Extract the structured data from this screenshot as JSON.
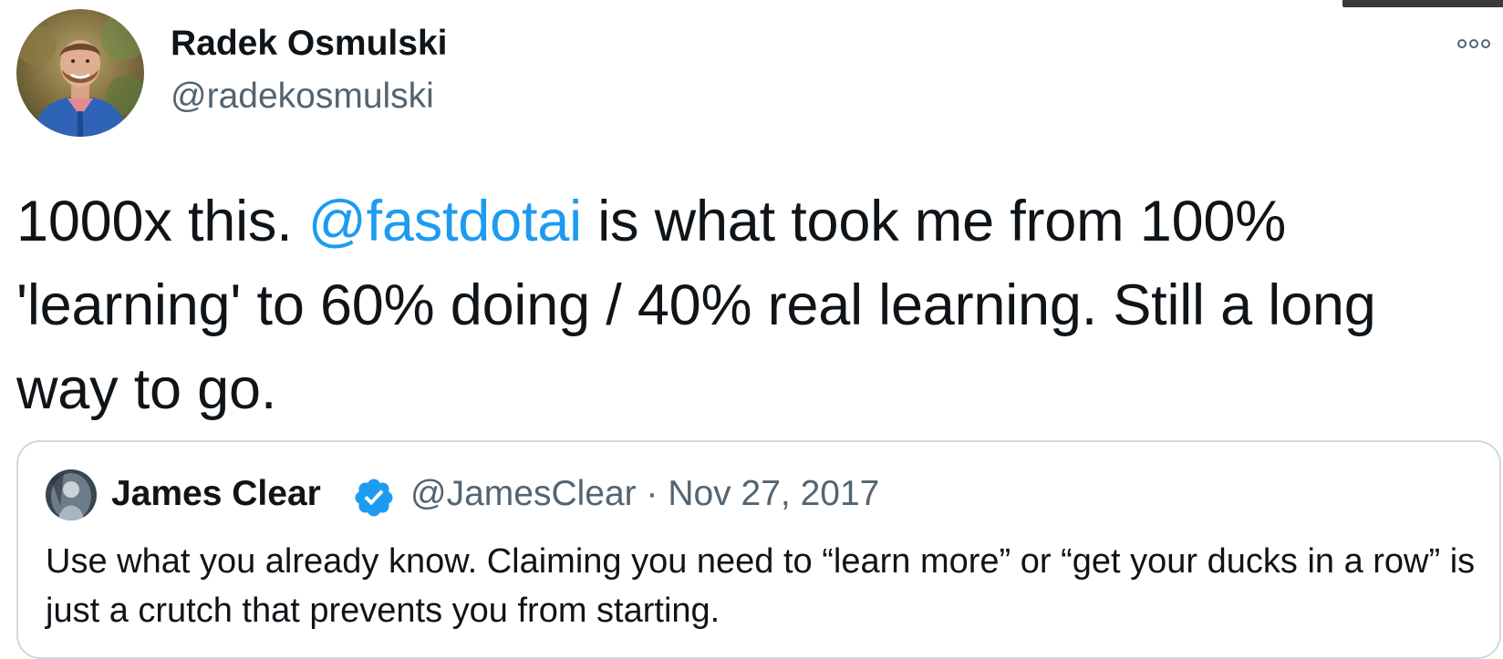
{
  "tweet": {
    "author": {
      "display_name": "Radek Osmulski",
      "handle": "@radekosmulski"
    },
    "text": {
      "before_mention": "1000x this. ",
      "mention": "@fastdotai",
      "after_mention": " is what took me from 100% 'learning' to 60% doing / 40% real learning. Still a long way to go."
    },
    "more_icon": "more-horizontal-icon"
  },
  "quoted_tweet": {
    "author": {
      "display_name": "James Clear",
      "verified_icon": "verified-badge-icon",
      "handle": "@JamesClear"
    },
    "separator": " · ",
    "date": "Nov 27, 2017",
    "text": "Use what you already know. Claiming you need to “learn more” or “get your ducks in a row” is just a crutch that prevents you from starting."
  },
  "colors": {
    "link": "#1d9bf0",
    "verified": "#1d9bf0",
    "secondary_text": "#536471",
    "border": "#cfd9de"
  }
}
